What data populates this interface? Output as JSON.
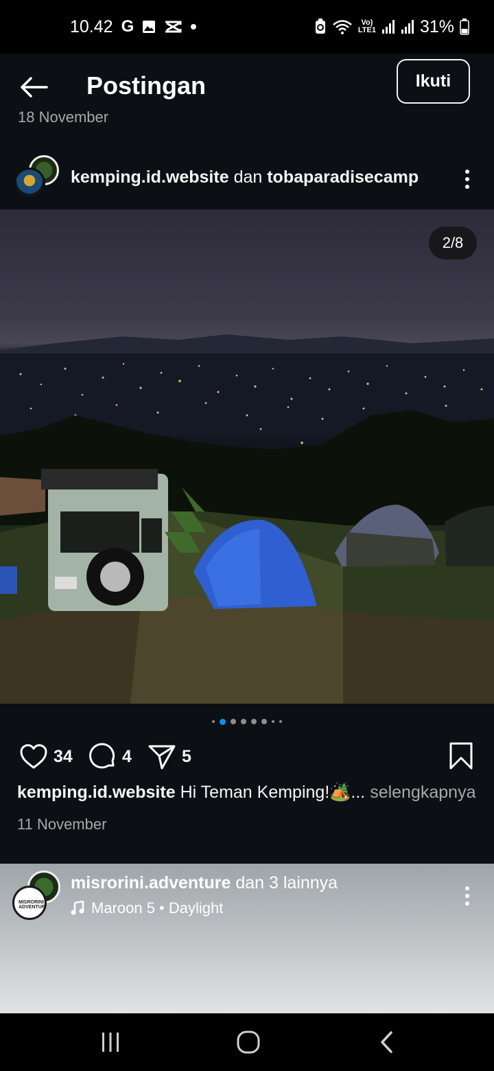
{
  "status_bar": {
    "time": "10.42",
    "battery": "31%",
    "net_label_top": "Vo)",
    "net_label_bottom": "LTE1"
  },
  "header": {
    "title": "Postingan",
    "follow_label": "Ikuti"
  },
  "previous_post": {
    "date_partial": "18 November"
  },
  "post": {
    "author": "kemping.id.website",
    "joiner": "dan",
    "collaborator": "tobaparadisecamp",
    "media_counter": "2/8",
    "likes": "34",
    "comments": "4",
    "shares": "5",
    "caption_author": "kemping.id.website",
    "caption_text": "Hi Teman Kemping!🏕️...",
    "caption_more": "selengkapnya",
    "date": "11 November"
  },
  "carousel": {
    "active_index": 1,
    "total_dots": 8
  },
  "next_post": {
    "author": "misrorini.adventure",
    "joiner": "dan 3 lainnya",
    "music": "Maroon 5 • Daylight",
    "avatar_text": "MISRORINI ADVENTURE"
  },
  "colors": {
    "background": "#0c1014",
    "accent_blue": "#0095f6",
    "text_secondary": "#a8a8a8"
  }
}
